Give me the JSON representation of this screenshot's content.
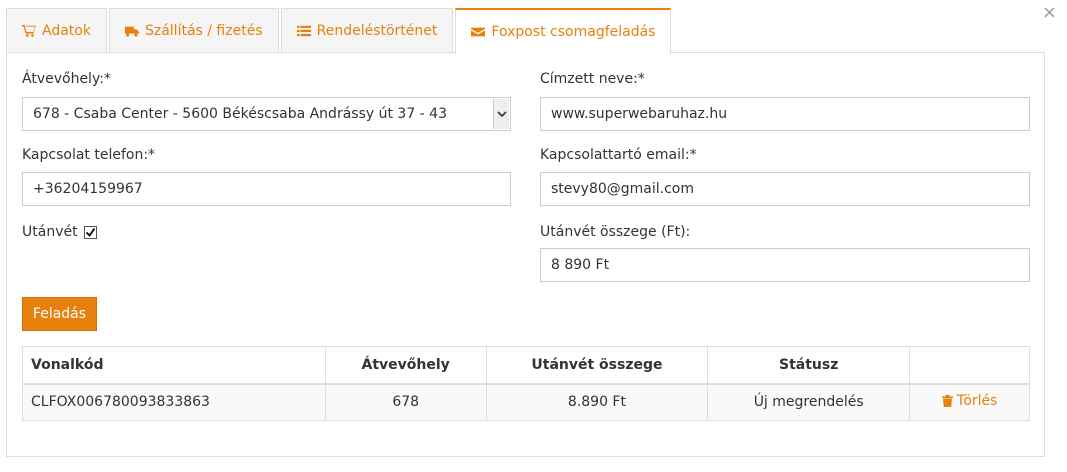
{
  "close_glyph": "×",
  "tabs": [
    {
      "label": "Adatok",
      "icon": "cart-icon"
    },
    {
      "label": "Szállítás / fizetés",
      "icon": "truck-icon"
    },
    {
      "label": "Rendeléstörténet",
      "icon": "list-icon"
    },
    {
      "label": "Foxpost csomagfeladás",
      "icon": "envelope-icon",
      "active": true
    }
  ],
  "form": {
    "pickup_label": "Átvevőhely:*",
    "pickup_value": "678 - Csaba Center - 5600 Békéscsaba Andrássy út 37 - 43",
    "recipient_label": "Címzett neve:*",
    "recipient_value": "www.superwebaruhaz.hu",
    "phone_label": "Kapcsolat telefon:*",
    "phone_value": "+36204159967",
    "email_label": "Kapcsolattartó email:*",
    "email_value": "stevy80@gmail.com",
    "cod_label": "Utánvét",
    "cod_checked": true,
    "cod_amount_label": "Utánvét összege (Ft):",
    "cod_amount_value": "8 890 Ft",
    "submit_label": "Feladás"
  },
  "table": {
    "headers": [
      "Vonalkód",
      "Átvevőhely",
      "Utánvét összege",
      "Státusz",
      ""
    ],
    "rows": [
      {
        "barcode": "CLFOX006780093833863",
        "pickup": "678",
        "amount": "8.890 Ft",
        "status": "Új megrendelés",
        "action": "Törlés"
      }
    ]
  },
  "colors": {
    "accent": "#e8800e",
    "border": "#dddddd"
  }
}
